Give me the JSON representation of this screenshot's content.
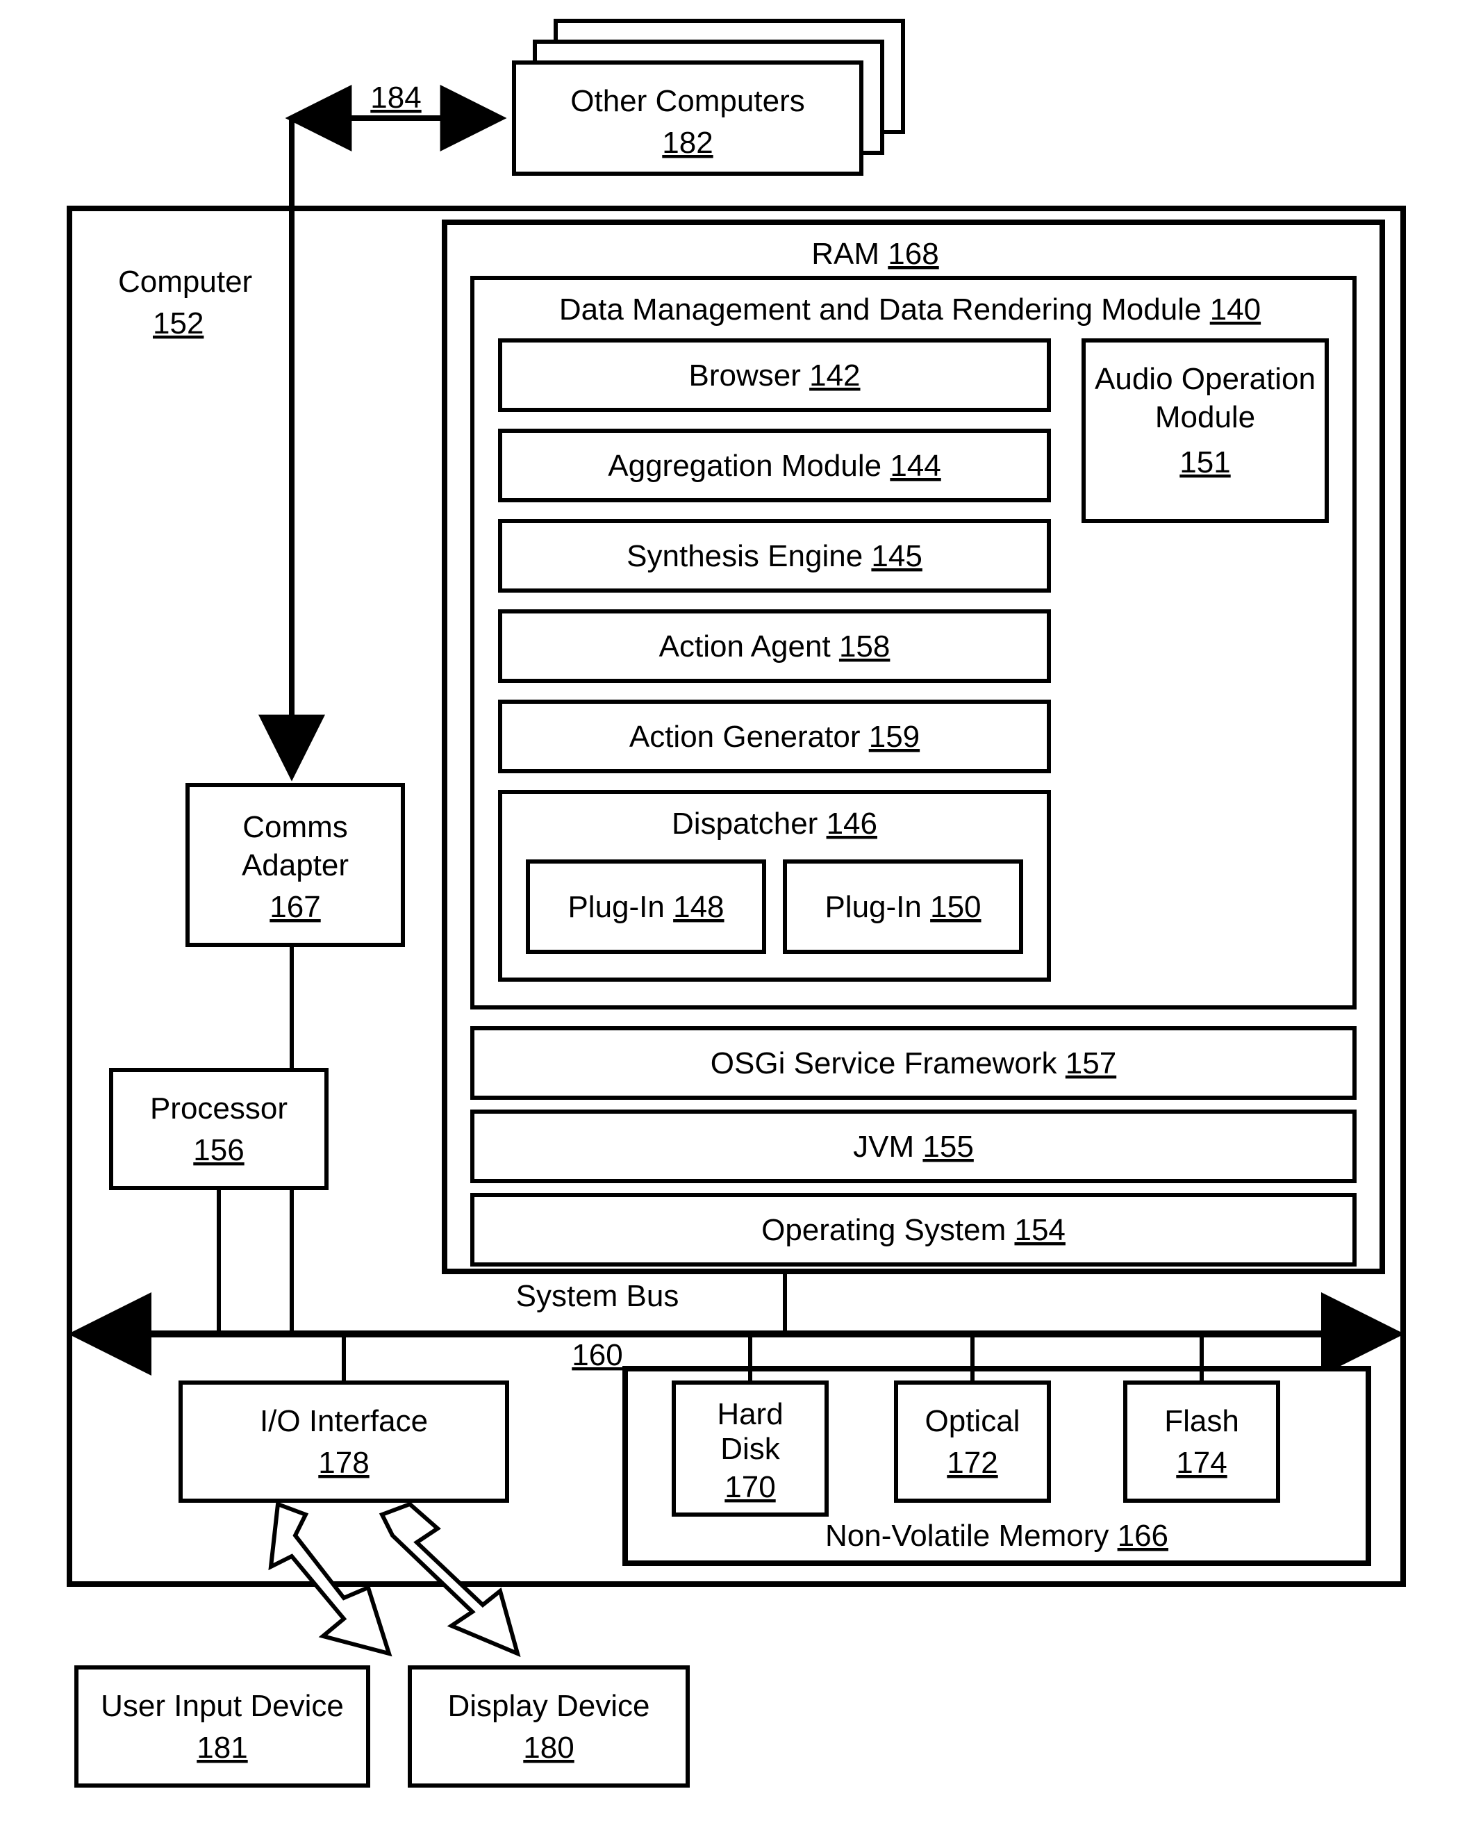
{
  "other_computers": {
    "label": "Other Computers",
    "num": "182"
  },
  "connection": {
    "num": "184"
  },
  "computer": {
    "label": "Computer",
    "num": "152"
  },
  "ram": {
    "label": "RAM",
    "num": "168"
  },
  "dmdr": {
    "label": "Data Management and Data Rendering Module",
    "num": "140"
  },
  "browser": {
    "label": "Browser",
    "num": "142"
  },
  "aggregation": {
    "label": "Aggregation Module",
    "num": "144"
  },
  "synth": {
    "label": "Synthesis Engine",
    "num": "145"
  },
  "agent": {
    "label": "Action Agent",
    "num": "158"
  },
  "generator": {
    "label": "Action Generator",
    "num": "159"
  },
  "dispatcher": {
    "label": "Dispatcher",
    "num": "146"
  },
  "plugin1": {
    "label": "Plug-In",
    "num": "148"
  },
  "plugin2": {
    "label": "Plug-In",
    "num": "150"
  },
  "audio": {
    "label1": "Audio Operation",
    "label2": "Module",
    "num": "151"
  },
  "osgi": {
    "label": "OSGi Service Framework",
    "num": "157"
  },
  "jvm": {
    "label": "JVM",
    "num": "155"
  },
  "os": {
    "label": "Operating System",
    "num": "154"
  },
  "comms": {
    "label1": "Comms",
    "label2": "Adapter",
    "num": "167"
  },
  "processor": {
    "label": "Processor",
    "num": "156"
  },
  "bus": {
    "label": "System Bus",
    "num": "160"
  },
  "io": {
    "label": "I/O Interface",
    "num": "178"
  },
  "hd": {
    "label1": "Hard",
    "label2": "Disk",
    "num": "170"
  },
  "optical": {
    "label": "Optical",
    "num": "172"
  },
  "flash": {
    "label": "Flash",
    "num": "174"
  },
  "nvm": {
    "label": "Non-Volatile Memory",
    "num": "166"
  },
  "uid": {
    "label": "User Input Device",
    "num": "181"
  },
  "display": {
    "label": "Display Device",
    "num": "180"
  }
}
